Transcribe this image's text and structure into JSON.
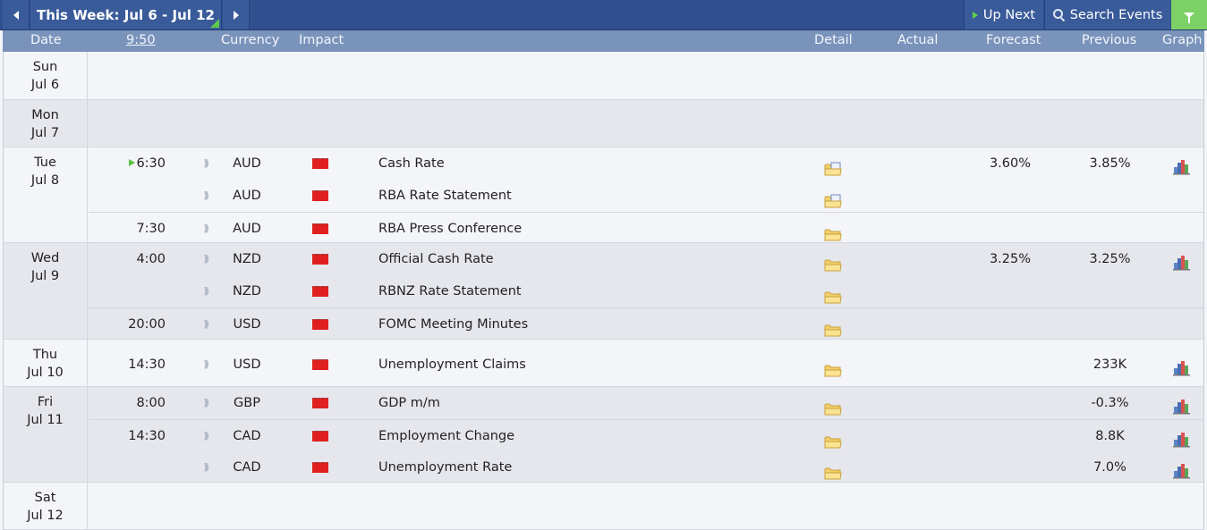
{
  "toolbar": {
    "week_label": "This Week: Jul 6 - Jul 12",
    "up_next_label": "Up Next",
    "search_label": "Search Events"
  },
  "columns": {
    "date": "Date",
    "time": "9:50",
    "currency": "Currency",
    "impact": "Impact",
    "detail": "Detail",
    "actual": "Actual",
    "forecast": "Forecast",
    "previous": "Previous",
    "graph": "Graph"
  },
  "colors": {
    "toolbar_bg": "#2f4f8f",
    "header_bg": "#7a93bb",
    "high_impact": "#e02020",
    "filter_green": "#7cd066"
  },
  "days": [
    {
      "dow": "Sun",
      "date": "Jul 6",
      "events": []
    },
    {
      "dow": "Mon",
      "date": "Jul 7",
      "events": []
    },
    {
      "dow": "Tue",
      "date": "Jul 8",
      "events": [
        {
          "time": "6:30",
          "next_marker": true,
          "currency": "AUD",
          "impact": "high",
          "title": "Cash Rate",
          "detail_icon": "folder-doc-icon",
          "forecast": "3.60%",
          "previous": "3.85%",
          "graph": true
        },
        {
          "time": "",
          "currency": "AUD",
          "impact": "high",
          "title": "RBA Rate Statement",
          "detail_icon": "folder-doc-icon",
          "forecast": "",
          "previous": "",
          "graph": false
        },
        {
          "time": "7:30",
          "currency": "AUD",
          "impact": "high",
          "title": "RBA Press Conference",
          "detail_icon": "folder-icon",
          "forecast": "",
          "previous": "",
          "graph": false,
          "sep": true
        }
      ]
    },
    {
      "dow": "Wed",
      "date": "Jul 9",
      "events": [
        {
          "time": "4:00",
          "currency": "NZD",
          "impact": "high",
          "title": "Official Cash Rate",
          "detail_icon": "folder-icon",
          "forecast": "3.25%",
          "previous": "3.25%",
          "graph": true
        },
        {
          "time": "",
          "currency": "NZD",
          "impact": "high",
          "title": "RBNZ Rate Statement",
          "detail_icon": "folder-icon",
          "forecast": "",
          "previous": "",
          "graph": false
        },
        {
          "time": "20:00",
          "currency": "USD",
          "impact": "high",
          "title": "FOMC Meeting Minutes",
          "detail_icon": "folder-icon",
          "forecast": "",
          "previous": "",
          "graph": false,
          "sep": true
        }
      ]
    },
    {
      "dow": "Thu",
      "date": "Jul 10",
      "events": [
        {
          "time": "14:30",
          "currency": "USD",
          "impact": "high",
          "title": "Unemployment Claims",
          "detail_icon": "folder-icon",
          "forecast": "",
          "previous": "233K",
          "graph": true
        }
      ]
    },
    {
      "dow": "Fri",
      "date": "Jul 11",
      "events": [
        {
          "time": "8:00",
          "currency": "GBP",
          "impact": "high",
          "title": "GDP m/m",
          "detail_icon": "folder-icon",
          "forecast": "",
          "previous": "-0.3%",
          "graph": true
        },
        {
          "time": "14:30",
          "currency": "CAD",
          "impact": "high",
          "title": "Employment Change",
          "detail_icon": "folder-icon",
          "forecast": "",
          "previous": "8.8K",
          "graph": true,
          "sep": true
        },
        {
          "time": "",
          "currency": "CAD",
          "impact": "high",
          "title": "Unemployment Rate",
          "detail_icon": "folder-icon",
          "forecast": "",
          "previous": "7.0%",
          "graph": true
        }
      ]
    },
    {
      "dow": "Sat",
      "date": "Jul 12",
      "events": []
    }
  ]
}
